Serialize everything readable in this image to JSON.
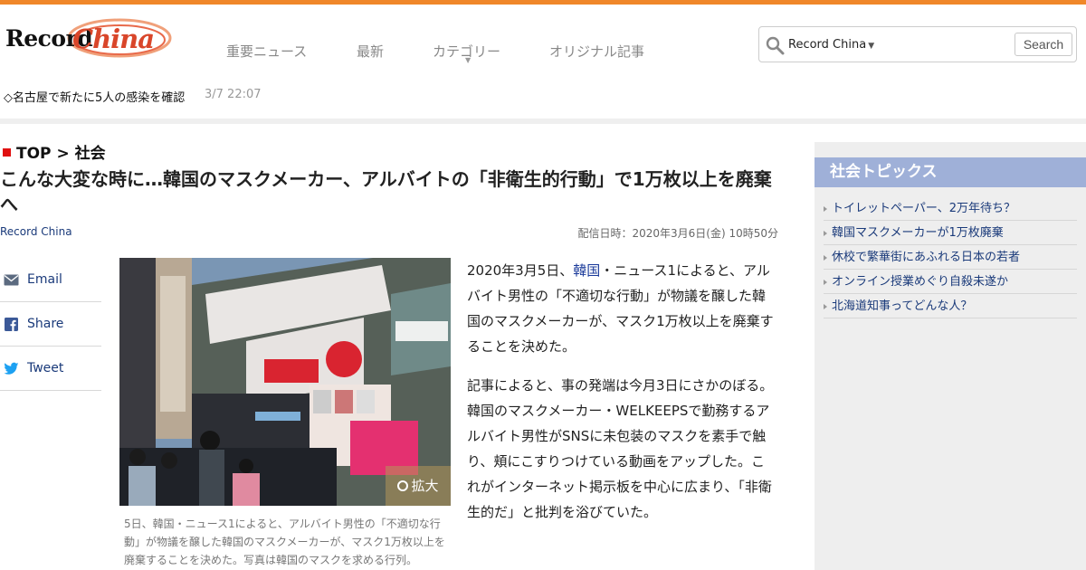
{
  "colors": {
    "accent": "#f0872a",
    "link": "#1a3a7a",
    "sidebar_head": "#9fb0d8",
    "breadcrumb_marker": "#e01010"
  },
  "logo": {
    "text_left": "Record",
    "text_right": "China"
  },
  "nav": [
    {
      "label": "重要ニュース"
    },
    {
      "label": "最新"
    },
    {
      "label": "カテゴリー",
      "has_dropdown": true
    },
    {
      "label": "オリジナル記事"
    }
  ],
  "search": {
    "scope": "Record China",
    "button": "Search",
    "value": "",
    "icon": "search-icon"
  },
  "ticker": {
    "text": "◇名古屋で新たに5人の感染を確認",
    "time": "3/7 22:07"
  },
  "breadcrumb": {
    "top": "TOP",
    "sep": ">",
    "current": "社会"
  },
  "article": {
    "title": "こんな大変な時に…韓国のマスクメーカー、アルバイトの「非衛生的行動」で1万枚以上を廃棄へ",
    "source": "Record China",
    "date": "配信日時：2020年3月6日(金) 10時50分",
    "photo_zoom": "拡大",
    "caption": "5日、韓国・ニュース1によると、アルバイト男性の「不適切な行動」が物議を醸した韓国のマスクメーカーが、マスク1万枚以上を廃棄することを決めた。写真は韓国のマスクを求める行列。",
    "p1_before": "2020年3月5日、",
    "p1_link": "韓国",
    "p1_after": "・ニュース1によると、アルバイト男性の「不適切な行動」が物議を醸した韓国のマスクメーカーが、マスク1万枚以上を廃棄することを決めた。",
    "p2": "記事によると、事の発端は今月3日にさかのぼる。韓国のマスクメーカー・WELKEEPSで勤務するアルバイト男性がSNSに未包装のマスクを素手で触り、頬にこすりつけている動画をアップした。これがインターネット掲示板を中心に広まり、「非衛生的だ」と批判を浴びていた。"
  },
  "share": [
    {
      "label": "Email",
      "icon": "email-icon"
    },
    {
      "label": "Share",
      "icon": "facebook-icon"
    },
    {
      "label": "Tweet",
      "icon": "twitter-icon"
    }
  ],
  "sidebar": {
    "title": "社会トピックス",
    "items": [
      {
        "label": "トイレットペーパー、2万年待ち？"
      },
      {
        "label": "韓国マスクメーカーが1万枚廃棄"
      },
      {
        "label": "休校で繁華街にあふれる日本の若者"
      },
      {
        "label": "オンライン授業めぐり自殺未遂か"
      },
      {
        "label": "北海道知事ってどんな人？"
      }
    ]
  }
}
